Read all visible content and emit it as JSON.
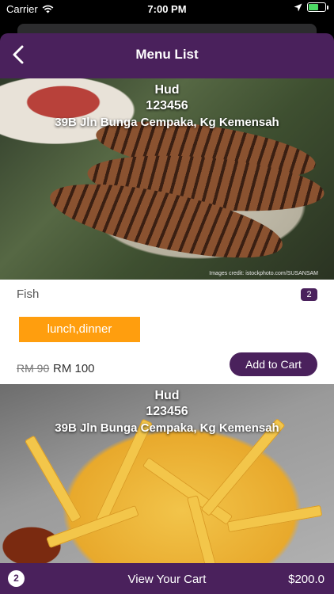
{
  "status_bar": {
    "carrier": "Carrier",
    "time": "7:00 PM",
    "icons": [
      "wifi-icon",
      "location-arrow-icon",
      "battery-charging-icon"
    ]
  },
  "header": {
    "title": "Menu List",
    "back_icon": "chevron-left-icon"
  },
  "menu_items": [
    {
      "shop_name": "Hud",
      "shop_phone": "123456",
      "shop_address": "39B Jln Bunga Cempaka, Kg Kemensah",
      "image_credit": "Images credit: istockphoto.com/SUSANSAM",
      "name": "Fish",
      "count": "2",
      "tags": "lunch,dinner",
      "old_price": "RM 90",
      "price": "RM 100",
      "add_to_cart": "Add to Cart"
    },
    {
      "shop_name": "Hud",
      "shop_phone": "123456",
      "shop_address": "39B Jln Bunga Cempaka, Kg Kemensah"
    }
  ],
  "cart_bar": {
    "count": "2",
    "label": "View Your Cart",
    "total": "$200.0"
  },
  "colors": {
    "brand_purple": "#4a215c",
    "tag_orange": "#ff9e0e"
  }
}
